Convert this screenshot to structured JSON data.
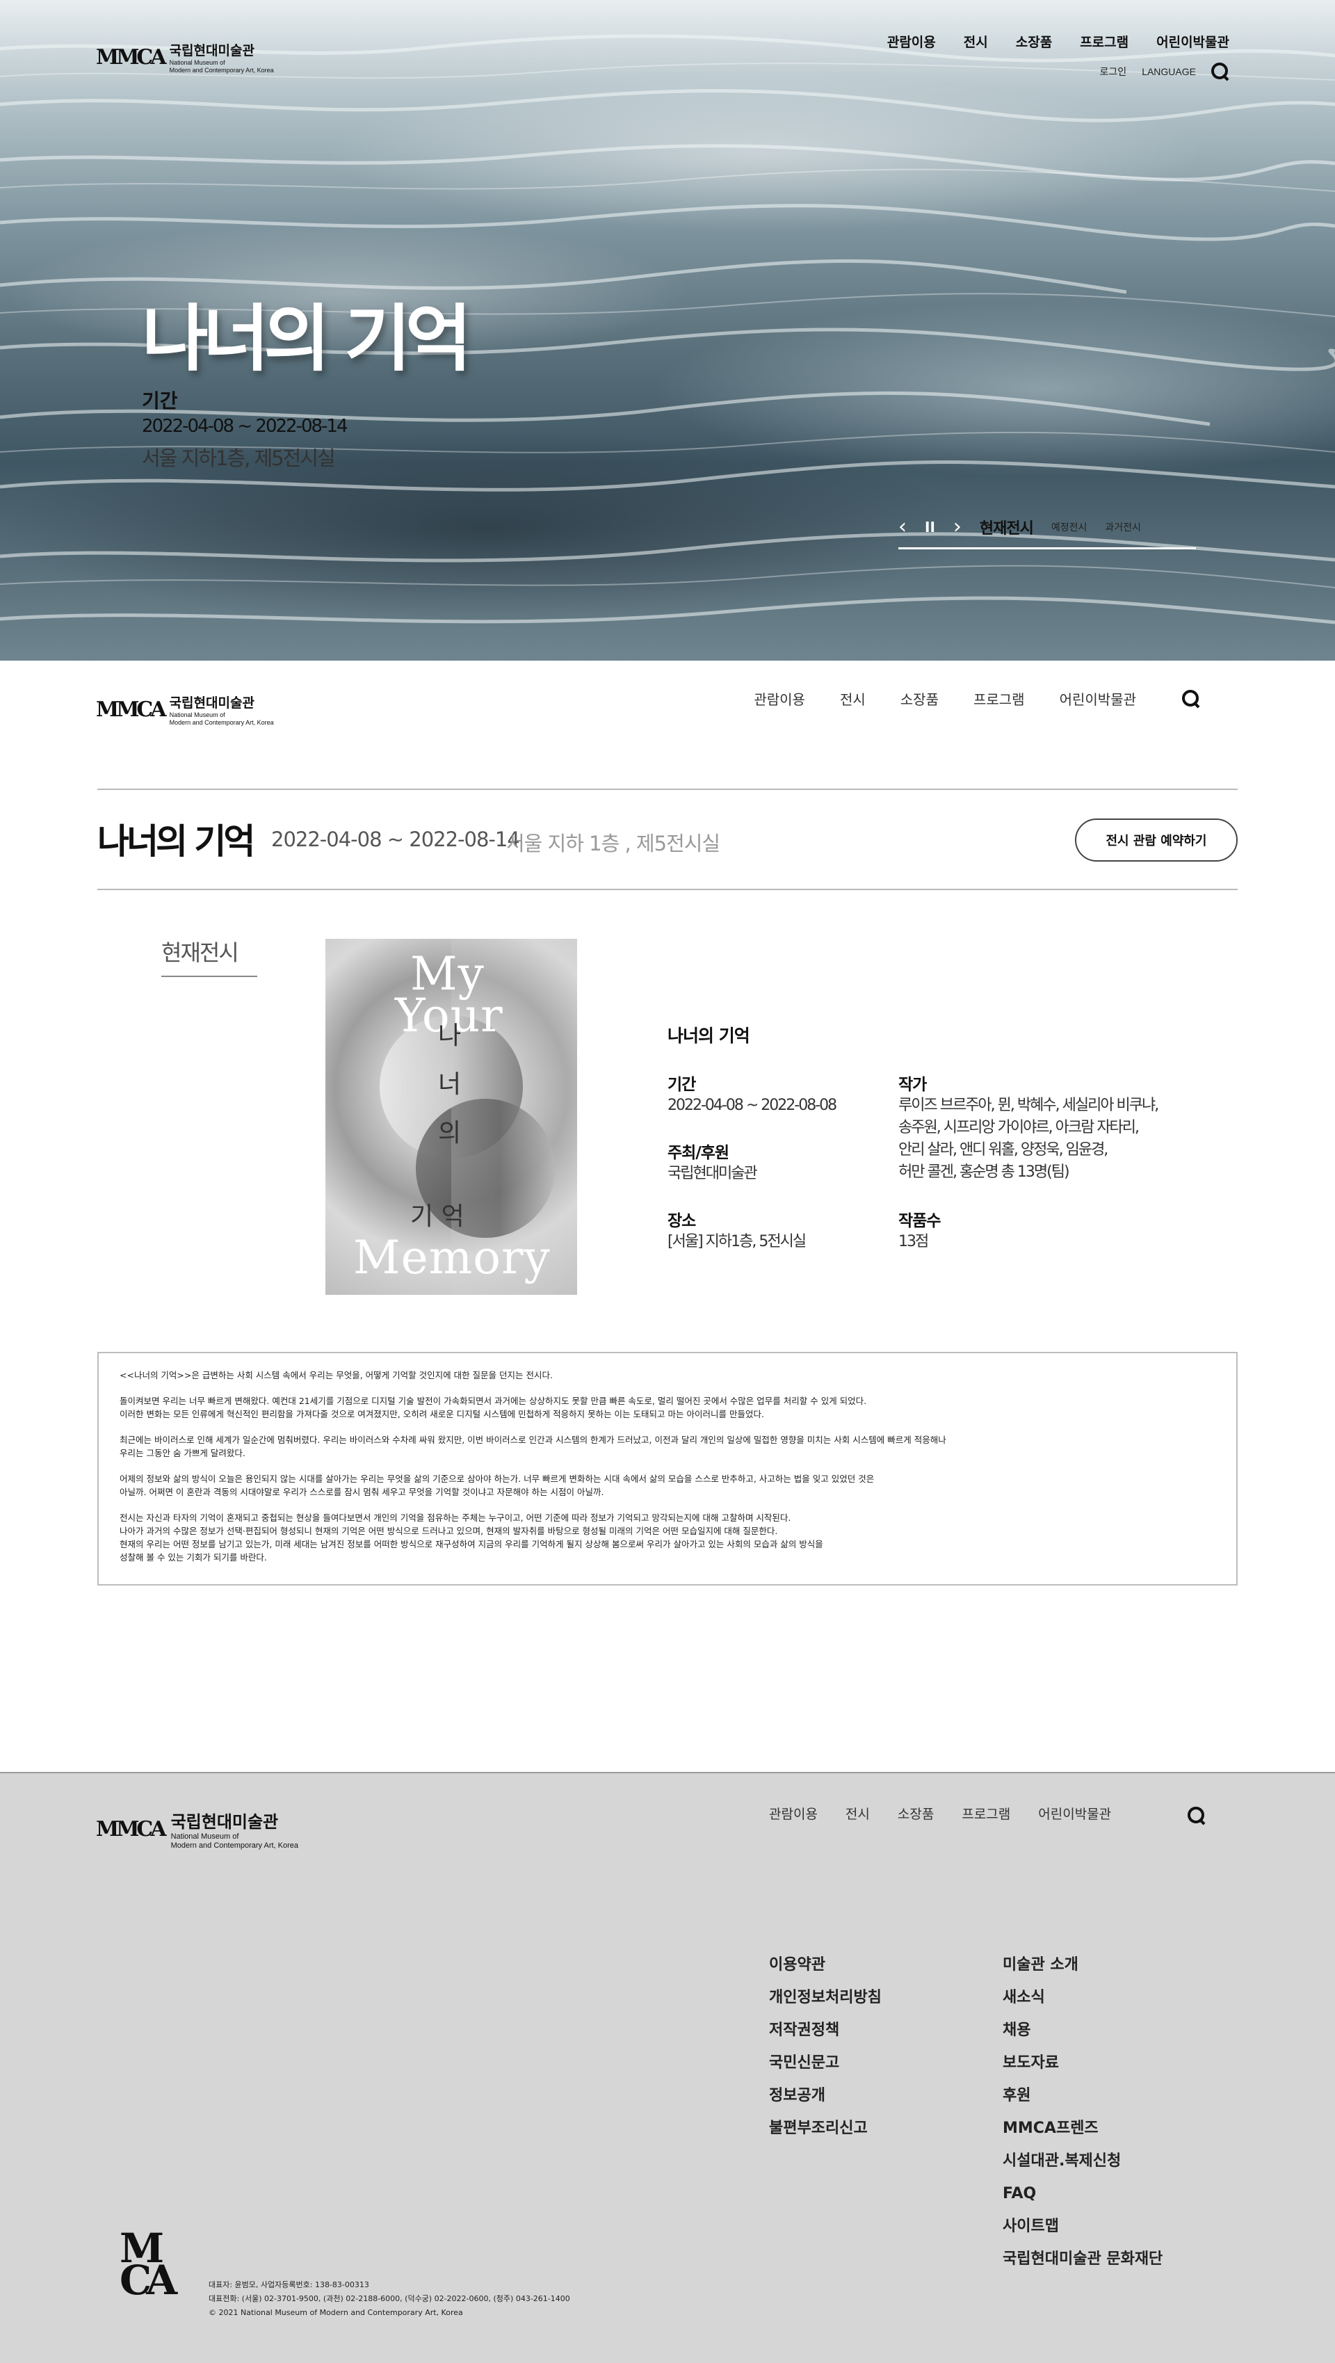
{
  "brand": {
    "name_ko": "국립현대미술관",
    "name_en_1": "National Museum of",
    "name_en_2": "Modern and Contemporary Art, Korea",
    "mark": "MMCA"
  },
  "hero": {
    "nav": [
      "관람이용",
      "전시",
      "소장품",
      "프로그램",
      "어린이박물관"
    ],
    "util": {
      "login": "로그인",
      "language": "LANGUAGE",
      "extra": "검색"
    },
    "title": "나너의 기억",
    "period_label": "기간",
    "period": "2022-04-08 ~ 2022-08-14",
    "place": "서울 지하1층, 제5전시실",
    "slider": {
      "prev": "‹",
      "pause": "II",
      "next": "›",
      "current": "현재전시",
      "upcoming": "예정전시",
      "past": "과거전시"
    }
  },
  "subnav": [
    "관람이용",
    "전시",
    "소장품",
    "프로그램",
    "어린이박물관"
  ],
  "exhibition": {
    "title": "나너의 기억",
    "date": "2022-04-08 ~ 2022-08-14",
    "place": "서울 지하 1층 , 제5전시실",
    "reserve": "전시 관람 예약하기",
    "tab": "현재전시",
    "poster": {
      "en_top_1": "My",
      "en_top_2": "Your",
      "ko_1": "나",
      "ko_2": "너",
      "ko_3": "의",
      "ko_4": "기 억",
      "en_bottom": "Memory"
    },
    "info": {
      "title": "나너의 기억",
      "period_label": "기간",
      "period": "2022-04-08 ~ 2022-08-08",
      "host_label": "주최/후원",
      "host": "국립현대미술관",
      "venue_label": "장소",
      "venue": "[서울] 지하1층, 5전시실",
      "artist_label": "작가",
      "artist_lines": [
        "루이즈 브르주아, 뮌, 박혜수, 세실리아 비쿠냐,",
        "송주원, 시프리앙 가이야르, 아크람 자타리,",
        "안리 살라, 앤디 워홀, 양정욱, 임윤경,",
        "허만 콜겐, 홍순명 총 13명(팀)"
      ],
      "count_label": "작품수",
      "count": "13점"
    }
  },
  "description": {
    "lines": [
      "<<나너의 기억>>은 급변하는 사회 시스템 속에서 우리는 무엇을, 어떻게 기억할 것인지에 대한 질문을 던지는 전시다.",
      "",
      "돌이켜보면 우리는 너무 빠르게 변해왔다. 예컨대 21세기를 기점으로 디지털 기술 발전이 가속화되면서 과거에는 상상하지도 못할 만큼 빠른 속도로, 멀리 떨어진 곳에서 수많은 업무를 처리할 수 있게 되었다.",
      "이러한 변화는 모든 인류에게 혁신적인 편리함을 가져다줄 것으로 여겨졌지만, 오히려 새로운 디지털 시스템에 민첩하게 적응하지 못하는 이는 도태되고 마는 아이러니를 만들었다.",
      "",
      "최근에는 바이러스로 인해 세계가 일순간에 멈춰버렸다. 우리는 바이러스와 수차례 싸워 왔지만, 이번 바이러스로 인간과 시스템의 한계가 드러났고, 이전과 달리 개인의 일상에 밀접한 영향을 미치는 사회 시스템에 빠르게 적응해나",
      "우리는 그동안 숨 가쁘게 달려왔다.",
      "",
      "어제의 정보와 삶의 방식이 오늘은 용인되지 않는 시대를 살아가는 우리는 무엇을 삶의 기준으로 삼아야 하는가. 너무 빠르게 변화하는 시대 속에서 삶의 모습을 스스로 반추하고, 사고하는 법을 잊고 있었던 것은",
      "아닐까. 어쩌면 이 혼란과 격동의 시대야말로 우리가 스스로를 잠시 멈춰 세우고 무엇을 기억할 것이냐고 자문해야 하는 시점이 아닐까.",
      "",
      "전시는 자신과 타자의 기억이 혼재되고 중첩되는 현상을 들여다보면서 개인의 기억을 점유하는 주체는 누구이고, 어떤 기준에 따라 정보가 기억되고 망각되는지에 대해 고찰하며 시작된다.",
      "나아가 과거의 수많은 정보가 선택·편집되어 형성되니 현재의 기억은 어떤 방식으로 드러나고 있으며, 현재의 발자취를 바탕으로 형성될 미래의 기억은 어떤 모습일지에 대해 질문한다.",
      "현재의 우리는 어떤 정보를 남기고 있는가, 미래 세대는 남겨진 정보를 어떠한 방식으로 재구성하여 지금의 우리를 기억하게 될지 상상해 봄으로써 우리가 살아가고 있는 사회의 모습과 삶의 방식을",
      "성찰해 볼 수 있는 기회가 되기를 바란다."
    ]
  },
  "footer": {
    "nav": [
      "관람이용",
      "전시",
      "소장품",
      "프로그램",
      "어린이박물관"
    ],
    "links_left": [
      "이용약관",
      "개인정보처리방침",
      "저작권정책",
      "국민신문고",
      "정보공개",
      "불편부조리신고"
    ],
    "links_right": [
      "미술관 소개",
      "새소식",
      "채용",
      "보도자료",
      "후원",
      "MMCA프렌즈",
      "시설대관.복제신청",
      "FAQ",
      "사이트맵",
      "국립현대미술관 문화재단"
    ],
    "info_1": "대표자: 윤범모, 사업자등록번호: 138-83-00313",
    "info_2": "대표전화: (서울) 02-3701-9500, (과천) 02-2188-6000, (덕수궁) 02-2022-0600, (청주) 043-261-1400",
    "info_3": "© 2021 National Museum of Modern and Contemporary Art, Korea"
  }
}
